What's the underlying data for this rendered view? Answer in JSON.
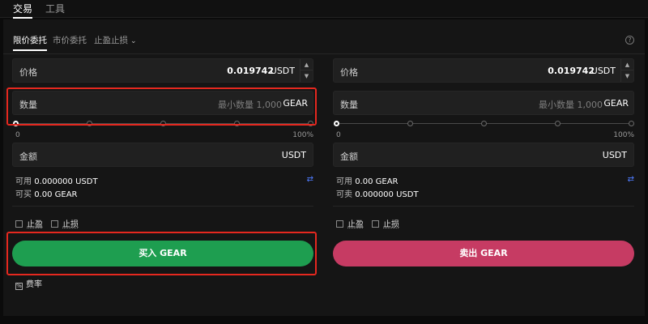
{
  "top_tabs": [
    "交易",
    "工具"
  ],
  "order_tabs": {
    "limit": "限价委托",
    "market": "市价委托",
    "tpsl": "止盈止损"
  },
  "buy": {
    "price_label": "价格",
    "price_value": "0.019742",
    "price_unit": "USDT",
    "qty_label": "数量",
    "qty_placeholder": "最小数量 1,000",
    "qty_unit": "GEAR",
    "slider_min": "0",
    "slider_max": "100%",
    "slider_percent": 0,
    "amount_label": "金额",
    "amount_unit": "USDT",
    "avail_label": "可用",
    "avail_value": "0.000000 USDT",
    "can_label": "可买",
    "can_value": "0.00 GEAR",
    "tp_label": "止盈",
    "sl_label": "止损",
    "button": "买入 GEAR"
  },
  "sell": {
    "price_label": "价格",
    "price_value": "0.019742",
    "price_unit": "USDT",
    "qty_label": "数量",
    "qty_placeholder": "最小数量 1,000",
    "qty_unit": "GEAR",
    "slider_min": "0",
    "slider_max": "100%",
    "slider_percent": 0,
    "amount_label": "金额",
    "amount_unit": "USDT",
    "avail_label": "可用",
    "avail_value": "0.00 GEAR",
    "can_label": "可卖",
    "can_value": "0.000000 USDT",
    "tp_label": "止盈",
    "sl_label": "止损",
    "button": "卖出 GEAR"
  },
  "fee_label": "费率",
  "colors": {
    "buy": "#1e9e50",
    "sell": "#c63b63",
    "highlight": "#e5281f",
    "swap": "#4f7cff"
  },
  "icons": {
    "help": "question-circle-icon",
    "swap": "swap-arrows-icon",
    "stepper": "up-down-stepper-icon",
    "fee": "fee-rate-icon",
    "chevron": "chevron-down-icon"
  }
}
